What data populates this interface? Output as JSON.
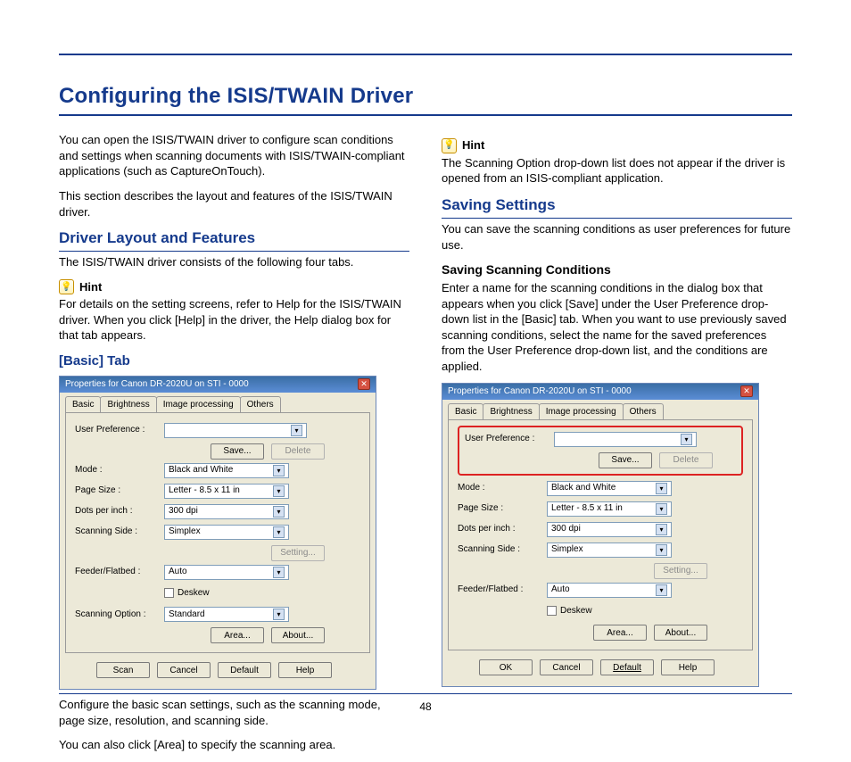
{
  "page": {
    "number": "48",
    "title": "Configuring the ISIS/TWAIN Driver"
  },
  "left": {
    "p1": "You can open the ISIS/TWAIN driver to configure scan conditions and settings when scanning documents with ISIS/TWAIN-compliant applications (such as CaptureOnTouch).",
    "p2": "This section describes the layout and features of the ISIS/TWAIN driver.",
    "sec1_title": "Driver Layout and Features",
    "sec1_p": "The ISIS/TWAIN driver consists of the following four tabs.",
    "hint_label": "Hint",
    "hint_p": "For details on the setting screens, refer to Help for the ISIS/TWAIN driver. When you click [Help] in the driver, the Help dialog box for that tab appears.",
    "sec2_title": "[Basic] Tab",
    "sec2_p1": "Configure the basic scan settings, such as the scanning mode, page size, resolution, and scanning side.",
    "sec2_p2": "You can also click [Area] to specify the scanning area."
  },
  "right": {
    "hint_label": "Hint",
    "hint_p": "The Scanning Option drop-down list does not appear if the driver is opened from an ISIS-compliant application.",
    "sec_title": "Saving Settings",
    "sec_p": "You can save the scanning conditions as user preferences for future use.",
    "sub_title": "Saving Scanning Conditions",
    "sub_p": "Enter a name for the scanning conditions in the dialog box that appears when you click [Save] under the User Preference drop-down list in the [Basic] tab. When you want to use previously saved scanning conditions, select the name for the saved preferences from the User Preference drop-down list, and the conditions are applied."
  },
  "dialog": {
    "title": "Properties for Canon DR-2020U on STI - 0000",
    "tabs": {
      "t1": "Basic",
      "t2": "Brightness",
      "t3": "Image processing",
      "t4": "Others"
    },
    "labels": {
      "user_pref": "User Preference :",
      "mode": "Mode :",
      "page_size": "Page Size :",
      "dpi": "Dots per inch :",
      "side": "Scanning Side :",
      "feeder": "Feeder/Flatbed :",
      "scan_opt": "Scanning Option :",
      "deskew": "Deskew"
    },
    "values": {
      "user_pref": "",
      "mode": "Black and White",
      "page_size": "Letter - 8.5 x 11 in",
      "dpi": "300 dpi",
      "side": "Simplex",
      "feeder": "Auto",
      "scan_opt": "Standard"
    },
    "buttons": {
      "save": "Save...",
      "delete": "Delete",
      "setting": "Setting...",
      "area": "Area...",
      "about": "About...",
      "scan": "Scan",
      "cancel": "Cancel",
      "default": "Default",
      "help": "Help",
      "ok": "OK"
    }
  }
}
